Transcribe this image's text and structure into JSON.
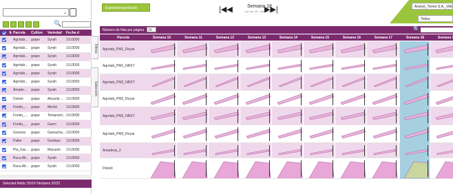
{
  "left_panel": {
    "select_value": "",
    "search_placeholder": "",
    "columns": [
      "Parcela",
      "Cultivo",
      "Variedad",
      "Fecha d"
    ],
    "rows": [
      {
        "parcela": "Agrolab...",
        "cultivo": "grape",
        "variedad": "Syrah",
        "fecha": "1/1/3000"
      },
      {
        "parcela": "Agrolab...",
        "cultivo": "grape",
        "variedad": "Syrah",
        "fecha": "1/1/3000"
      },
      {
        "parcela": "Agrolab...",
        "cultivo": "grape",
        "variedad": "Syrah",
        "fecha": "1/1/3000"
      },
      {
        "parcela": "Agrolab...",
        "cultivo": "grape",
        "variedad": "Syrah",
        "fecha": "1/1/3000"
      },
      {
        "parcela": "Agrolab...",
        "cultivo": "grape",
        "variedad": "Syrah",
        "fecha": "1/1/3000"
      },
      {
        "parcela": "Agrolab...",
        "cultivo": "grape",
        "variedad": "Syrah",
        "fecha": "1/1/3000"
      },
      {
        "parcela": "Amade...",
        "cultivo": "grape",
        "variedad": "Syrah",
        "fecha": "1/1/3000"
      },
      {
        "parcela": "Divisió",
        "cultivo": "grape",
        "variedad": "Alicante ...",
        "fecha": "1/1/3000"
      },
      {
        "parcela": "Fondo_...",
        "cultivo": "grape",
        "variedad": "Merlot",
        "fecha": "1/1/3000"
      },
      {
        "parcela": "Fondo_...",
        "cultivo": "grape",
        "variedad": "Tempranil...",
        "fecha": "1/1/3000"
      },
      {
        "parcela": "Fondo_...",
        "cultivo": "grape",
        "variedad": "Garro",
        "fecha": "1/1/3000"
      },
      {
        "parcela": "Gravera",
        "cultivo": "grape",
        "variedad": "Garnacha...",
        "fecha": "1/1/3000"
      },
      {
        "parcela": "Paller",
        "cultivo": "grape",
        "variedad": "Gonfaus",
        "fecha": "1/1/3000"
      },
      {
        "parcela": "Pla_Gar...",
        "cultivo": "grape",
        "variedad": "Macuelo",
        "fecha": "1/1/3000"
      },
      {
        "parcela": "Roca Alt...",
        "cultivo": "grape",
        "variedad": "Syrah",
        "fecha": "1/1/3000"
      },
      {
        "parcela": "Roca Alt...",
        "cultivo": "grape",
        "variedad": "Syrah",
        "fecha": "1/1/3000"
      }
    ],
    "footer": "Selected fields: 55/16 Hectares 32/32",
    "tab_filters": "Filtros",
    "tab_selection": "Selección"
  },
  "header": {
    "export_button": "Exportar/exportación",
    "week_title": "Semana 18",
    "week_dates": "jue abr 28 - mie 04 2022",
    "company": "Aranyó_Torres S.A._Viñe",
    "filter": "Todos"
  },
  "grid": {
    "rows_label": "Número de filas por página",
    "rows_per_page": "10",
    "parcela_header": "Parcela",
    "weeks": [
      "Semana 10",
      "Semana 11",
      "Semana 12",
      "Semana 13",
      "Semana 14",
      "Semana 15",
      "Semana 16",
      "Semana 17",
      "Semana 18",
      "Semana 19"
    ],
    "selected_week_index": 8,
    "rows": [
      "Agrolab_PM1_Royat",
      "Agrolab_PM1_NRST",
      "Agrolab_PM2_NRST",
      "Agrolab_PM2_Royat",
      "Agrolab_PM3_NRST",
      "Agrolab_PM3_Royat",
      "Amadeus_2",
      "Divisió"
    ]
  },
  "colors": {
    "accent": "#7b2a6e",
    "green": "#9bc53d",
    "selected_col": "#a6cfe0",
    "row_pink": "#f0d8ec"
  }
}
